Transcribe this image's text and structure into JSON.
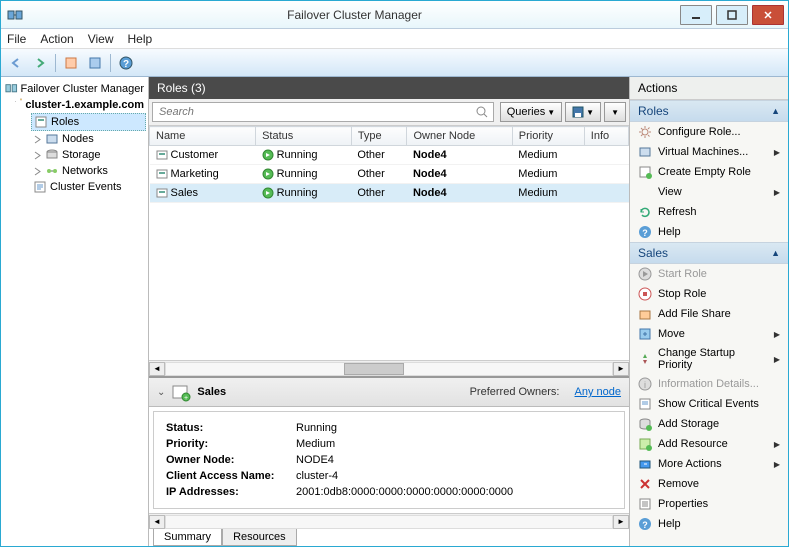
{
  "window": {
    "title": "Failover Cluster Manager"
  },
  "menubar": {
    "file": "File",
    "action": "Action",
    "view": "View",
    "help": "Help"
  },
  "nav": {
    "root": "Failover Cluster Manager",
    "cluster": "cluster-1.example.com",
    "items": [
      "Roles",
      "Nodes",
      "Storage",
      "Networks",
      "Cluster Events"
    ]
  },
  "roles_header": "Roles (3)",
  "search": {
    "placeholder": "Search",
    "queries_label": "Queries"
  },
  "columns": {
    "name": "Name",
    "status": "Status",
    "type": "Type",
    "owner": "Owner Node",
    "priority": "Priority",
    "info": "Info"
  },
  "roles": [
    {
      "name": "Customer",
      "status": "Running",
      "type": "Other",
      "owner": "Node4",
      "priority": "Medium",
      "selected": false
    },
    {
      "name": "Marketing",
      "status": "Running",
      "type": "Other",
      "owner": "Node4",
      "priority": "Medium",
      "selected": false
    },
    {
      "name": "Sales",
      "status": "Running",
      "type": "Other",
      "owner": "Node4",
      "priority": "Medium",
      "selected": true
    }
  ],
  "detail": {
    "title": "Sales",
    "pref_label": "Preferred Owners:",
    "pref_link": "Any node",
    "rows": {
      "status_lbl": "Status:",
      "status_val": "Running",
      "priority_lbl": "Priority:",
      "priority_val": "Medium",
      "owner_lbl": "Owner Node:",
      "owner_val": "NODE4",
      "can_lbl": "Client Access Name:",
      "can_val": "cluster-4",
      "ip_lbl": "IP Addresses:",
      "ip_val": "2001:0db8:0000:0000:0000:0000:0000:0000"
    },
    "tabs": {
      "summary": "Summary",
      "resources": "Resources"
    }
  },
  "actions": {
    "header": "Actions",
    "roles_section": "Roles",
    "roles_items": [
      {
        "label": "Configure Role...",
        "icon": "gear",
        "submenu": false
      },
      {
        "label": "Virtual Machines...",
        "icon": "vm",
        "submenu": true
      },
      {
        "label": "Create Empty Role",
        "icon": "role",
        "submenu": false
      },
      {
        "label": "View",
        "icon": "none",
        "submenu": true
      },
      {
        "label": "Refresh",
        "icon": "refresh",
        "submenu": false
      },
      {
        "label": "Help",
        "icon": "help",
        "submenu": false
      }
    ],
    "sel_section": "Sales",
    "sel_items": [
      {
        "label": "Start Role",
        "icon": "start",
        "disabled": true
      },
      {
        "label": "Stop Role",
        "icon": "stop",
        "disabled": false
      },
      {
        "label": "Add File Share",
        "icon": "share",
        "disabled": false
      },
      {
        "label": "Move",
        "icon": "move",
        "submenu": true
      },
      {
        "label": "Change Startup Priority",
        "icon": "priority",
        "submenu": true
      },
      {
        "label": "Information Details...",
        "icon": "info",
        "disabled": true
      },
      {
        "label": "Show Critical Events",
        "icon": "events"
      },
      {
        "label": "Add Storage",
        "icon": "storage"
      },
      {
        "label": "Add Resource",
        "icon": "resource",
        "submenu": true
      },
      {
        "label": "More Actions",
        "icon": "more",
        "submenu": true
      },
      {
        "label": "Remove",
        "icon": "remove"
      },
      {
        "label": "Properties",
        "icon": "props"
      },
      {
        "label": "Help",
        "icon": "help"
      }
    ]
  }
}
